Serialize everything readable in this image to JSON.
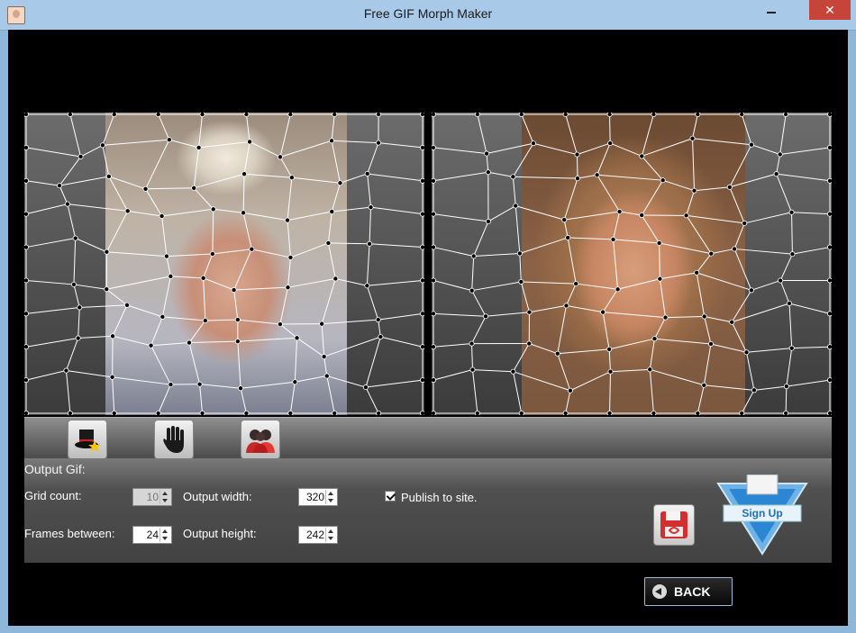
{
  "window": {
    "title": "Free GIF Morph Maker",
    "close_glyph": "✕"
  },
  "output": {
    "title": "Output Gif:",
    "grid_count_label": "Grid count:",
    "grid_count_value": "10",
    "frames_between_label": "Frames between:",
    "frames_between_value": "24",
    "output_width_label": "Output width:",
    "output_width_value": "320",
    "output_height_label": "Output height:",
    "output_height_value": "242",
    "publish_label": "Publish to site.",
    "publish_checked": true
  },
  "signup": {
    "label": "Sign Up"
  },
  "nav": {
    "back_label": "BACK"
  },
  "icons": {
    "toolbar": [
      "magic-hat-icon",
      "hand-icon",
      "people-icon"
    ],
    "save": "save-disk-icon",
    "back": "back-arrow-icon"
  },
  "colors": {
    "titlebar": "#a9c9e8",
    "close_button": "#c7443b",
    "mesh_line": "#ffffff",
    "mesh_point": "#000000",
    "signup_text": "#1d6fb9"
  }
}
